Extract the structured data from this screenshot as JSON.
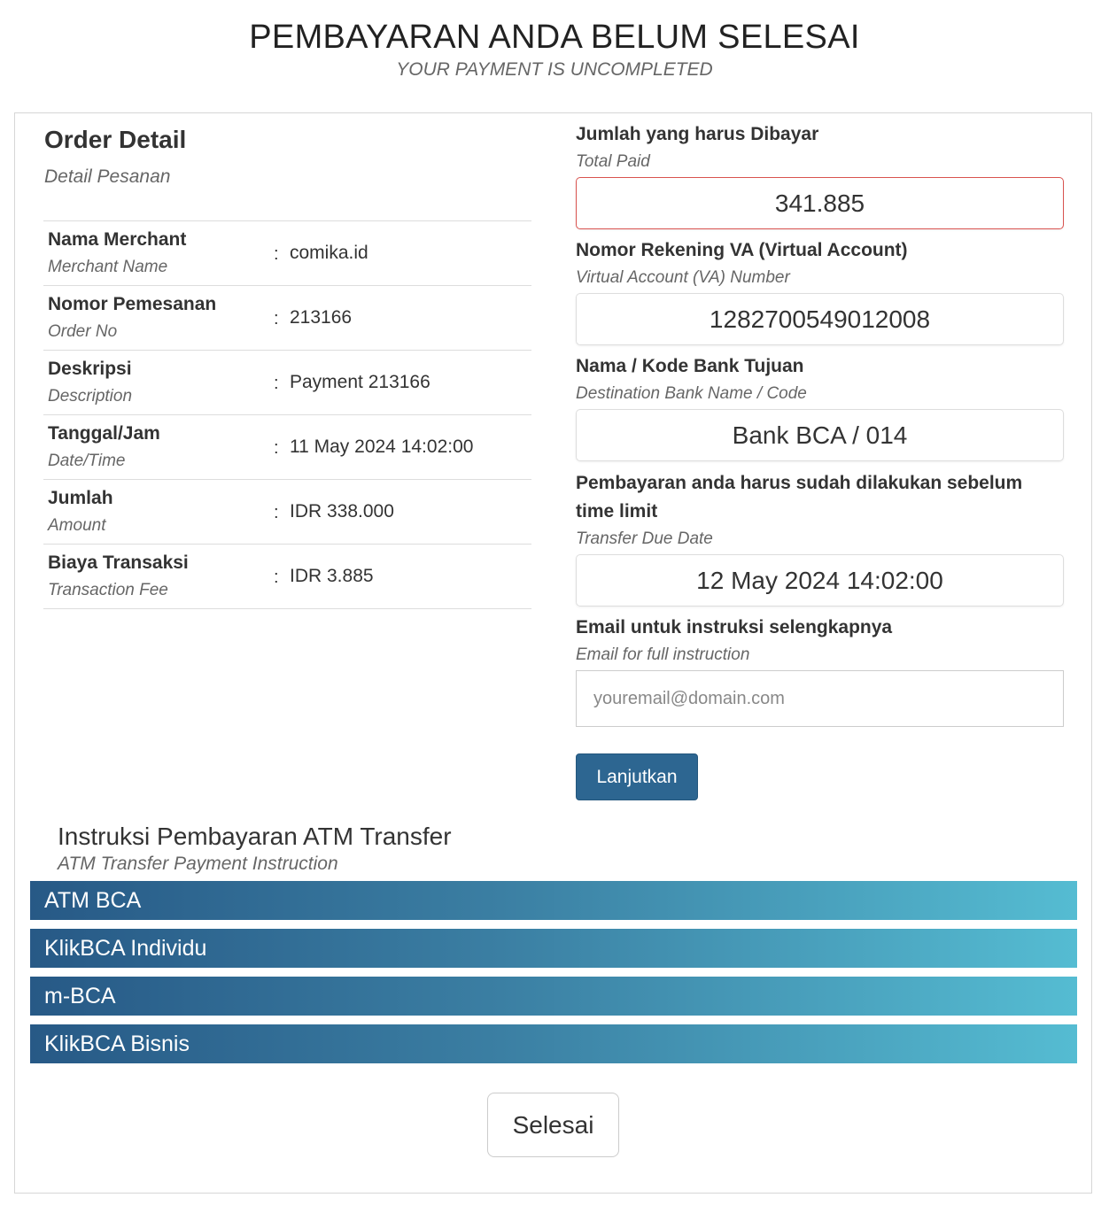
{
  "header": {
    "title": "PEMBAYARAN ANDA BELUM SELESAI",
    "subtitle": "YOUR PAYMENT IS UNCOMPLETED"
  },
  "order": {
    "title": "Order Detail",
    "subtitle": "Detail Pesanan",
    "rows": [
      {
        "label": "Nama Merchant",
        "sublabel": "Merchant Name",
        "colon": ":",
        "value": "comika.id"
      },
      {
        "label": "Nomor Pemesanan",
        "sublabel": "Order No",
        "colon": ":",
        "value": "213166"
      },
      {
        "label": "Deskripsi",
        "sublabel": "Description",
        "colon": ":",
        "value": "Payment 213166"
      },
      {
        "label": "Tanggal/Jam",
        "sublabel": "Date/Time",
        "colon": ":",
        "value": "11 May 2024 14:02:00"
      },
      {
        "label": "Jumlah",
        "sublabel": "Amount",
        "colon": ":",
        "value": "IDR 338.000"
      },
      {
        "label": "Biaya Transaksi",
        "sublabel": "Transaction Fee",
        "colon": ":",
        "value": "IDR 3.885"
      }
    ]
  },
  "payment": {
    "total": {
      "label": "Jumlah yang harus Dibayar",
      "sublabel": "Total Paid",
      "value": "341.885"
    },
    "va": {
      "label": "Nomor Rekening VA (Virtual Account)",
      "sublabel": "Virtual Account (VA) Number",
      "value": "1282700549012008"
    },
    "bank": {
      "label": "Nama / Kode Bank Tujuan",
      "sublabel": "Destination Bank Name / Code",
      "value": "Bank BCA / 014"
    },
    "due": {
      "label": "Pembayaran anda harus sudah dilakukan sebelum time limit",
      "sublabel": "Transfer Due Date",
      "value": "12 May 2024 14:02:00"
    },
    "email": {
      "label": "Email untuk instruksi selengkapnya",
      "sublabel": "Email for full instruction",
      "placeholder": "youremail@domain.com",
      "value": ""
    },
    "continue_label": "Lanjutkan"
  },
  "instructions": {
    "title": "Instruksi Pembayaran ATM Transfer",
    "subtitle": "ATM Transfer Payment Instruction",
    "items": [
      "ATM BCA",
      "KlikBCA Individu",
      "m-BCA",
      "KlikBCA Bisnis"
    ]
  },
  "done_label": "Selesai",
  "colors": {
    "primary_button": "#2d6691",
    "danger_border": "#d9534f",
    "accordion_start": "#275986",
    "accordion_end": "#55bcd2"
  }
}
